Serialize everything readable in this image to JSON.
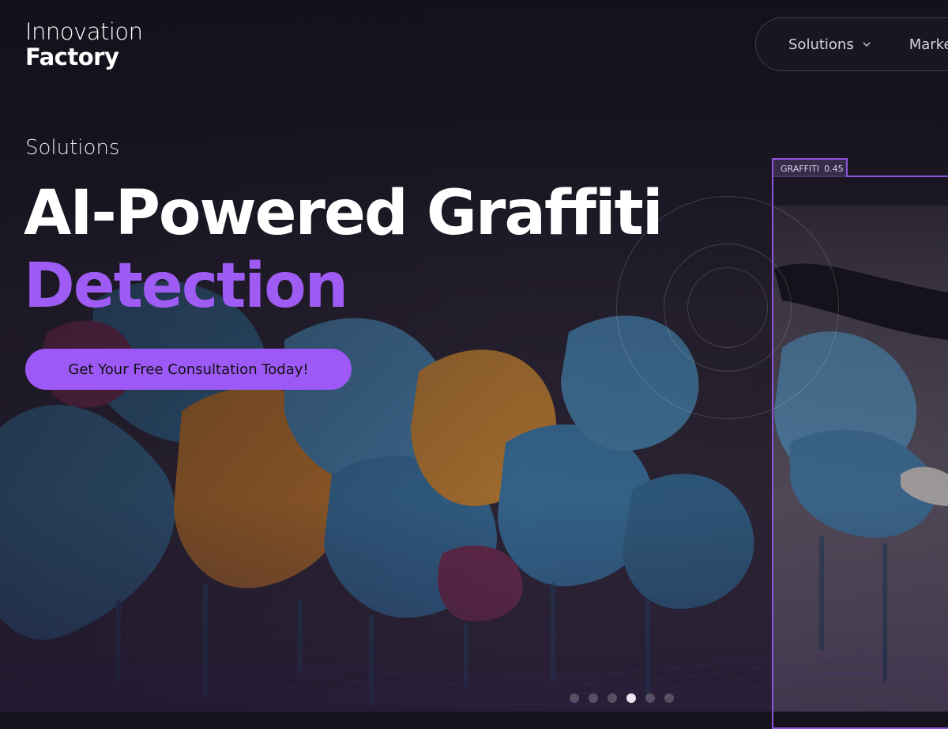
{
  "brand": {
    "line1": "Innovation",
    "line2": "Factory"
  },
  "nav": {
    "items": [
      {
        "label": "Solutions",
        "has_dropdown": true
      },
      {
        "label": "Marke",
        "has_dropdown": false
      }
    ]
  },
  "hero": {
    "eyebrow": "Solutions",
    "headline_line1": "AI-Powered Graffiti",
    "headline_line2": "Detection",
    "cta_label": "Get Your Free Consultation Today!"
  },
  "detection": {
    "class_label": "GRAFFITI",
    "confidence": "0.45"
  },
  "carousel": {
    "slide_count": 6,
    "active_index": 3
  },
  "colors": {
    "accent": "#9d59f5",
    "headline_accent": "#9f5cf4",
    "background": "#15121c",
    "box": "#8d54e0"
  },
  "icons": {
    "dropdown": "chevron-down-icon"
  }
}
